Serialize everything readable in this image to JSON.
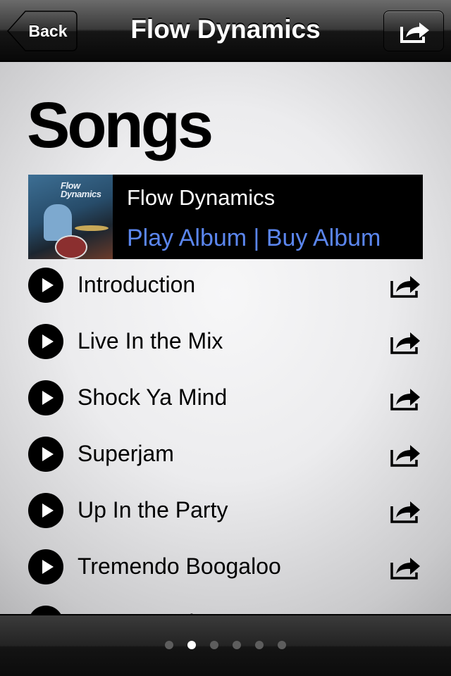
{
  "navbar": {
    "back_label": "Back",
    "title": "Flow Dynamics"
  },
  "page_title": "Songs",
  "album": {
    "name": "Flow Dynamics",
    "art_text": "Flow Dynamics",
    "play_label": "Play Album",
    "separator": " | ",
    "buy_label": "Buy Album",
    "link_color": "#5b86ee"
  },
  "songs": [
    {
      "title": "Introduction"
    },
    {
      "title": "Live In the Mix"
    },
    {
      "title": "Shock Ya Mind"
    },
    {
      "title": "Superjam"
    },
    {
      "title": "Up In the Party"
    },
    {
      "title": "Tremendo Boogaloo"
    },
    {
      "title": "Agua Segui"
    }
  ],
  "pager": {
    "page_count": 6,
    "current_page": 2
  }
}
